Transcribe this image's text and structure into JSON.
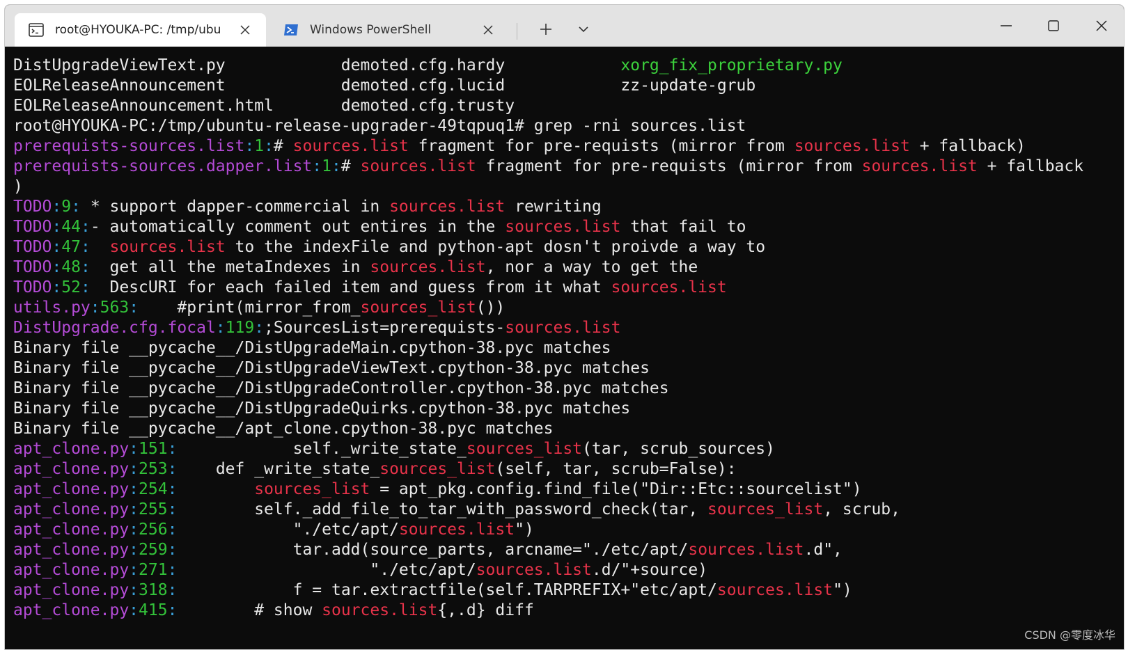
{
  "tabs": [
    {
      "label": "root@HYOUKA-PC: /tmp/ubu",
      "icon": "terminal-icon",
      "active": true
    },
    {
      "label": "Windows PowerShell",
      "icon": "powershell-icon",
      "active": false
    }
  ],
  "colors": {
    "background": "#0c0c0c",
    "text": "#e8e8e8",
    "filename": "#b44bd6",
    "linenumber": "#33c23a",
    "match": "#e8334a",
    "executable": "#3cd23c"
  },
  "terminal": {
    "lines": [
      [
        {
          "t": "DistUpgradeViewText.py            demoted.cfg.hardy            ",
          "c": "default"
        },
        {
          "t": "xorg_fix_proprietary.py",
          "c": "bgreen"
        }
      ],
      [
        {
          "t": "EOLReleaseAnnouncement            demoted.cfg.lucid            zz-update-grub",
          "c": "default"
        }
      ],
      [
        {
          "t": "EOLReleaseAnnouncement.html       demoted.cfg.trusty",
          "c": "default"
        }
      ],
      [
        {
          "t": "root@HYOUKA-PC:/tmp/ubuntu-release-upgrader-49tqpuq1# grep -rni sources.list",
          "c": "default"
        }
      ],
      [
        {
          "t": "prerequists-sources.list",
          "c": "purple"
        },
        {
          "t": ":",
          "c": "cyan"
        },
        {
          "t": "1",
          "c": "green"
        },
        {
          "t": ":",
          "c": "cyan"
        },
        {
          "t": "# ",
          "c": "default"
        },
        {
          "t": "sources.list",
          "c": "red"
        },
        {
          "t": " fragment for pre-requists (mirror from ",
          "c": "default"
        },
        {
          "t": "sources.list",
          "c": "red"
        },
        {
          "t": " + fallback)",
          "c": "default"
        }
      ],
      [
        {
          "t": "prerequists-sources.dapper.list",
          "c": "purple"
        },
        {
          "t": ":",
          "c": "cyan"
        },
        {
          "t": "1",
          "c": "green"
        },
        {
          "t": ":",
          "c": "cyan"
        },
        {
          "t": "# ",
          "c": "default"
        },
        {
          "t": "sources.list",
          "c": "red"
        },
        {
          "t": " fragment for pre-requists (mirror from ",
          "c": "default"
        },
        {
          "t": "sources.list",
          "c": "red"
        },
        {
          "t": " + fallback",
          "c": "default"
        }
      ],
      [
        {
          "t": ")",
          "c": "default"
        }
      ],
      [
        {
          "t": "TODO",
          "c": "purple"
        },
        {
          "t": ":",
          "c": "cyan"
        },
        {
          "t": "9",
          "c": "green"
        },
        {
          "t": ":",
          "c": "cyan"
        },
        {
          "t": " * support dapper-commercial in ",
          "c": "default"
        },
        {
          "t": "sources.list",
          "c": "red"
        },
        {
          "t": " rewriting",
          "c": "default"
        }
      ],
      [
        {
          "t": "TODO",
          "c": "purple"
        },
        {
          "t": ":",
          "c": "cyan"
        },
        {
          "t": "44",
          "c": "green"
        },
        {
          "t": ":",
          "c": "cyan"
        },
        {
          "t": "- automatically comment out entires in the ",
          "c": "default"
        },
        {
          "t": "sources.list",
          "c": "red"
        },
        {
          "t": " that fail to",
          "c": "default"
        }
      ],
      [
        {
          "t": "TODO",
          "c": "purple"
        },
        {
          "t": ":",
          "c": "cyan"
        },
        {
          "t": "47",
          "c": "green"
        },
        {
          "t": ":",
          "c": "cyan"
        },
        {
          "t": "  ",
          "c": "default"
        },
        {
          "t": "sources.list",
          "c": "red"
        },
        {
          "t": " to the indexFile and python-apt dosn't proivde a way to",
          "c": "default"
        }
      ],
      [
        {
          "t": "TODO",
          "c": "purple"
        },
        {
          "t": ":",
          "c": "cyan"
        },
        {
          "t": "48",
          "c": "green"
        },
        {
          "t": ":",
          "c": "cyan"
        },
        {
          "t": "  get all the metaIndexes in ",
          "c": "default"
        },
        {
          "t": "sources.list",
          "c": "red"
        },
        {
          "t": ", nor a way to get the",
          "c": "default"
        }
      ],
      [
        {
          "t": "TODO",
          "c": "purple"
        },
        {
          "t": ":",
          "c": "cyan"
        },
        {
          "t": "52",
          "c": "green"
        },
        {
          "t": ":",
          "c": "cyan"
        },
        {
          "t": "  DescURI for each failed item and guess from it what ",
          "c": "default"
        },
        {
          "t": "sources.list",
          "c": "red"
        }
      ],
      [
        {
          "t": "utils.py",
          "c": "purple"
        },
        {
          "t": ":",
          "c": "cyan"
        },
        {
          "t": "563",
          "c": "green"
        },
        {
          "t": ":",
          "c": "cyan"
        },
        {
          "t": "    #print(mirror_from_",
          "c": "default"
        },
        {
          "t": "sources_list",
          "c": "red"
        },
        {
          "t": "())",
          "c": "default"
        }
      ],
      [
        {
          "t": "DistUpgrade.cfg.focal",
          "c": "purple"
        },
        {
          "t": ":",
          "c": "cyan"
        },
        {
          "t": "119",
          "c": "green"
        },
        {
          "t": ":",
          "c": "cyan"
        },
        {
          "t": ";SourcesList=prerequists-",
          "c": "default"
        },
        {
          "t": "sources.list",
          "c": "red"
        }
      ],
      [
        {
          "t": "Binary file __pycache__/DistUpgradeMain.cpython-38.pyc matches",
          "c": "default"
        }
      ],
      [
        {
          "t": "Binary file __pycache__/DistUpgradeViewText.cpython-38.pyc matches",
          "c": "default"
        }
      ],
      [
        {
          "t": "Binary file __pycache__/DistUpgradeController.cpython-38.pyc matches",
          "c": "default"
        }
      ],
      [
        {
          "t": "Binary file __pycache__/DistUpgradeQuirks.cpython-38.pyc matches",
          "c": "default"
        }
      ],
      [
        {
          "t": "Binary file __pycache__/apt_clone.cpython-38.pyc matches",
          "c": "default"
        }
      ],
      [
        {
          "t": "apt_clone.py",
          "c": "purple"
        },
        {
          "t": ":",
          "c": "cyan"
        },
        {
          "t": "151",
          "c": "green"
        },
        {
          "t": ":",
          "c": "cyan"
        },
        {
          "t": "            self._write_state_",
          "c": "default"
        },
        {
          "t": "sources_list",
          "c": "red"
        },
        {
          "t": "(tar, scrub_sources)",
          "c": "default"
        }
      ],
      [
        {
          "t": "apt_clone.py",
          "c": "purple"
        },
        {
          "t": ":",
          "c": "cyan"
        },
        {
          "t": "253",
          "c": "green"
        },
        {
          "t": ":",
          "c": "cyan"
        },
        {
          "t": "    def _write_state_",
          "c": "default"
        },
        {
          "t": "sources_list",
          "c": "red"
        },
        {
          "t": "(self, tar, scrub=False):",
          "c": "default"
        }
      ],
      [
        {
          "t": "apt_clone.py",
          "c": "purple"
        },
        {
          "t": ":",
          "c": "cyan"
        },
        {
          "t": "254",
          "c": "green"
        },
        {
          "t": ":",
          "c": "cyan"
        },
        {
          "t": "        ",
          "c": "default"
        },
        {
          "t": "sources_list",
          "c": "red"
        },
        {
          "t": " = apt_pkg.config.find_file(\"Dir::Etc::sourcelist\")",
          "c": "default"
        }
      ],
      [
        {
          "t": "apt_clone.py",
          "c": "purple"
        },
        {
          "t": ":",
          "c": "cyan"
        },
        {
          "t": "255",
          "c": "green"
        },
        {
          "t": ":",
          "c": "cyan"
        },
        {
          "t": "        self._add_file_to_tar_with_password_check(tar, ",
          "c": "default"
        },
        {
          "t": "sources_list",
          "c": "red"
        },
        {
          "t": ", scrub,",
          "c": "default"
        }
      ],
      [
        {
          "t": "apt_clone.py",
          "c": "purple"
        },
        {
          "t": ":",
          "c": "cyan"
        },
        {
          "t": "256",
          "c": "green"
        },
        {
          "t": ":",
          "c": "cyan"
        },
        {
          "t": "            \"./etc/apt/",
          "c": "default"
        },
        {
          "t": "sources.list",
          "c": "red"
        },
        {
          "t": "\")",
          "c": "default"
        }
      ],
      [
        {
          "t": "apt_clone.py",
          "c": "purple"
        },
        {
          "t": ":",
          "c": "cyan"
        },
        {
          "t": "259",
          "c": "green"
        },
        {
          "t": ":",
          "c": "cyan"
        },
        {
          "t": "            tar.add(source_parts, arcname=\"./etc/apt/",
          "c": "default"
        },
        {
          "t": "sources.list",
          "c": "red"
        },
        {
          "t": ".d\",",
          "c": "default"
        }
      ],
      [
        {
          "t": "apt_clone.py",
          "c": "purple"
        },
        {
          "t": ":",
          "c": "cyan"
        },
        {
          "t": "271",
          "c": "green"
        },
        {
          "t": ":",
          "c": "cyan"
        },
        {
          "t": "                    \"./etc/apt/",
          "c": "default"
        },
        {
          "t": "sources.list",
          "c": "red"
        },
        {
          "t": ".d/\"+source)",
          "c": "default"
        }
      ],
      [
        {
          "t": "apt_clone.py",
          "c": "purple"
        },
        {
          "t": ":",
          "c": "cyan"
        },
        {
          "t": "318",
          "c": "green"
        },
        {
          "t": ":",
          "c": "cyan"
        },
        {
          "t": "            f = tar.extractfile(self.TARPREFIX+\"etc/apt/",
          "c": "default"
        },
        {
          "t": "sources.list",
          "c": "red"
        },
        {
          "t": "\")",
          "c": "default"
        }
      ],
      [
        {
          "t": "apt_clone.py",
          "c": "purple"
        },
        {
          "t": ":",
          "c": "cyan"
        },
        {
          "t": "415",
          "c": "green"
        },
        {
          "t": ":",
          "c": "cyan"
        },
        {
          "t": "        # show ",
          "c": "default"
        },
        {
          "t": "sources.list",
          "c": "red"
        },
        {
          "t": "{,.d} diff",
          "c": "default"
        }
      ]
    ]
  },
  "watermark": "CSDN @零度冰华"
}
